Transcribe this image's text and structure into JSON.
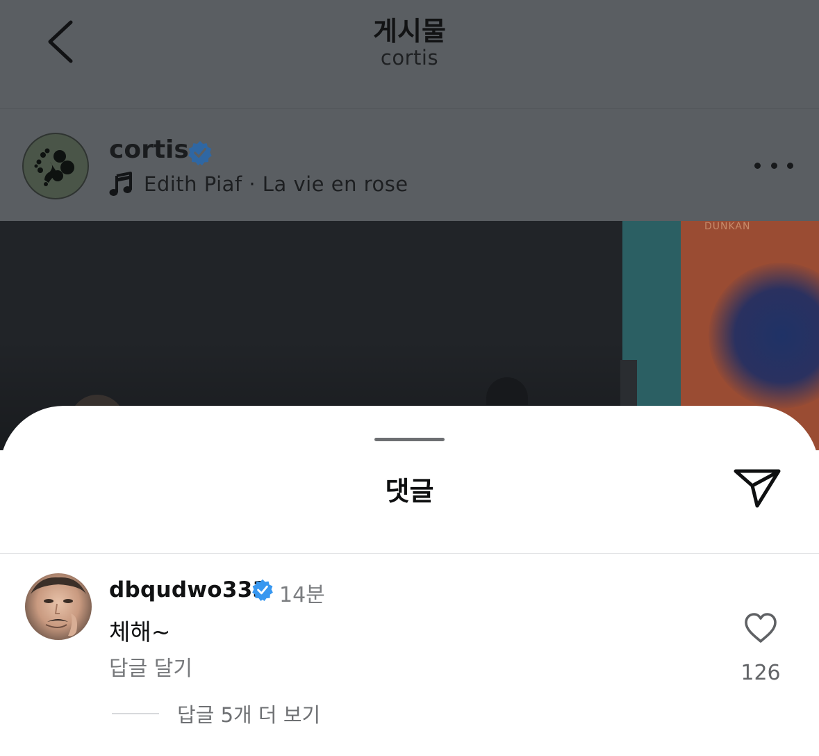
{
  "nav": {
    "title": "게시물",
    "subtitle": "cortis"
  },
  "post": {
    "username": "cortis",
    "verified": true,
    "music": "Edith Piaf · La vie en rose",
    "image_label": "DUNKAN"
  },
  "comments_sheet": {
    "title": "댓글",
    "comments": [
      {
        "username": "dbqudwo333",
        "verified": true,
        "time": "14분",
        "text": "체해~",
        "reply_label": "답글 달기",
        "like_count": "126",
        "more_replies_label": "답글 5개 더 보기"
      }
    ]
  },
  "colors": {
    "verified_blue": "#3797f0",
    "dim_overlay": "#5a5e62"
  },
  "icons": [
    "back-chevron-icon",
    "verified-badge-icon",
    "music-note-icon",
    "more-options-icon",
    "share-send-icon",
    "heart-icon"
  ]
}
